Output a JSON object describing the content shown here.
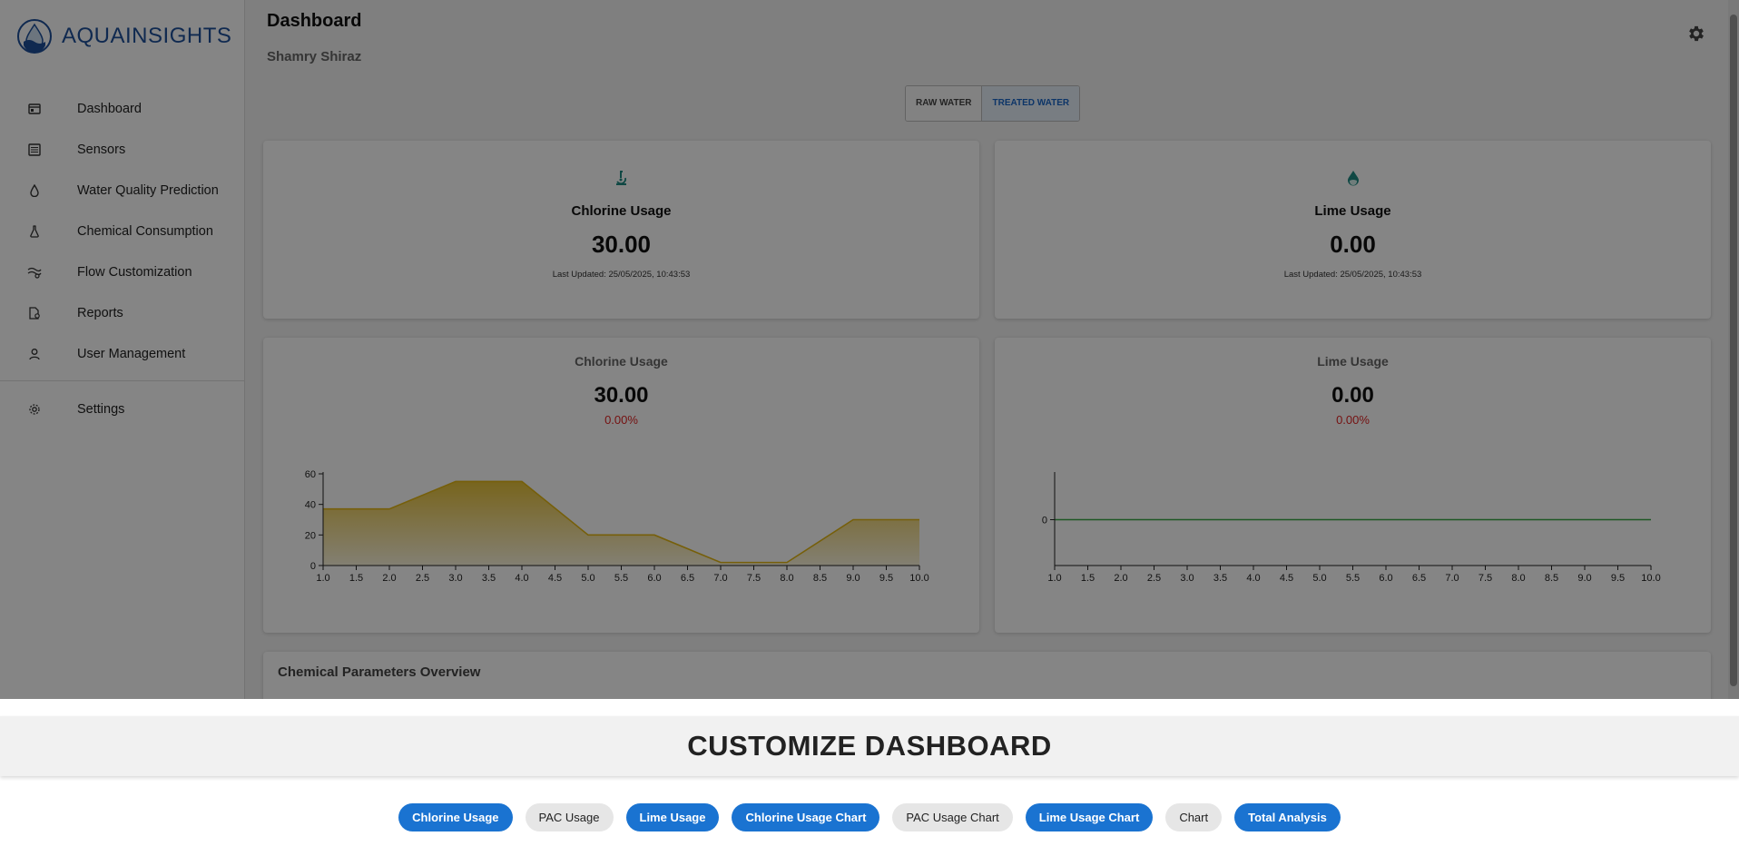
{
  "app": {
    "brand": "AQUAINSIGHTS"
  },
  "sidebar": {
    "items": [
      {
        "label": "Dashboard",
        "icon": "dashboard-icon"
      },
      {
        "label": "Sensors",
        "icon": "sensors-icon"
      },
      {
        "label": "Water Quality Prediction",
        "icon": "water-drop-icon"
      },
      {
        "label": "Chemical Consumption",
        "icon": "flask-icon"
      },
      {
        "label": "Flow Customization",
        "icon": "flow-icon"
      },
      {
        "label": "Reports",
        "icon": "reports-icon"
      },
      {
        "label": "User Management",
        "icon": "user-icon"
      },
      {
        "label": "Settings",
        "icon": "settings-icon"
      }
    ]
  },
  "header": {
    "title": "Dashboard",
    "subtitle": "Shamry Shiraz"
  },
  "toggle": {
    "raw": "RAW WATER",
    "treated": "TREATED WATER",
    "active": "treated"
  },
  "stats": [
    {
      "title": "Chlorine Usage",
      "value": "30.00",
      "updated": "Last Updated: 25/05/2025, 10:43:53",
      "icon": "microscope-icon",
      "icon_color": "#1f8a83"
    },
    {
      "title": "Lime Usage",
      "value": "0.00",
      "updated": "Last Updated: 25/05/2025, 10:43:53",
      "icon": "water-drop-icon",
      "icon_color": "#1f8a83"
    }
  ],
  "charts": [
    {
      "title": "Chlorine Usage",
      "value": "30.00",
      "change": "0.00%"
    },
    {
      "title": "Lime Usage",
      "value": "0.00",
      "change": "0.00%"
    }
  ],
  "chart_data": [
    {
      "type": "area",
      "title": "Chlorine Usage",
      "x": [
        1,
        2,
        3,
        4,
        5,
        6,
        7,
        8,
        9,
        10
      ],
      "xticks": [
        "1.0",
        "1.5",
        "2.0",
        "2.5",
        "3.0",
        "3.5",
        "4.0",
        "4.5",
        "5.0",
        "5.5",
        "6.0",
        "6.5",
        "7.0",
        "7.5",
        "8.0",
        "8.5",
        "9.0",
        "9.5",
        "10.0"
      ],
      "yticks": [
        "0",
        "20",
        "40",
        "60"
      ],
      "series": [
        {
          "values": [
            37,
            37,
            55,
            55,
            20,
            20,
            2,
            2,
            30,
            30
          ],
          "color": "#e2b615"
        }
      ],
      "xlim": [
        1,
        10
      ],
      "ylim": [
        0,
        60
      ],
      "grid": false
    },
    {
      "type": "line",
      "title": "Lime Usage",
      "x": [
        1,
        2,
        3,
        4,
        5,
        6,
        7,
        8,
        9,
        10
      ],
      "xticks": [
        "1.0",
        "1.5",
        "2.0",
        "2.5",
        "3.0",
        "3.5",
        "4.0",
        "4.5",
        "5.0",
        "5.5",
        "6.0",
        "6.5",
        "7.0",
        "7.5",
        "8.0",
        "8.5",
        "9.0",
        "9.5",
        "10.0"
      ],
      "yticks": [
        "0"
      ],
      "series": [
        {
          "values": [
            0,
            0,
            0,
            0,
            0,
            0,
            0,
            0,
            0,
            0
          ],
          "color": "#3aa845"
        }
      ],
      "xlim": [
        1,
        10
      ],
      "grid": false
    }
  ],
  "overview": {
    "title": "Chemical Parameters Overview"
  },
  "customize": {
    "title": "CUSTOMIZE DASHBOARD",
    "chips": [
      {
        "label": "Chlorine Usage",
        "selected": true
      },
      {
        "label": "PAC Usage",
        "selected": false
      },
      {
        "label": "Lime Usage",
        "selected": true
      },
      {
        "label": "Chlorine Usage Chart",
        "selected": true
      },
      {
        "label": "PAC Usage Chart",
        "selected": false
      },
      {
        "label": "Lime Usage Chart",
        "selected": true
      },
      {
        "label": "Chart",
        "selected": false
      },
      {
        "label": "Total Analysis",
        "selected": true
      }
    ]
  },
  "colors": {
    "brand": "#1e4f9a",
    "accent": "#1a73d1",
    "negative": "#e02424"
  }
}
